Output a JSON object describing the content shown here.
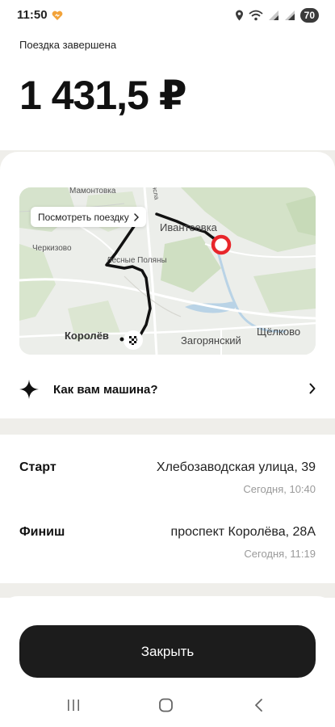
{
  "status_bar": {
    "time": "11:50",
    "battery": "70",
    "icons": [
      "heart-icon",
      "location-icon",
      "wifi-icon",
      "signal-icon",
      "signal-icon",
      "battery-icon"
    ]
  },
  "header": {
    "status": "Поездка завершена",
    "price": "1 431,5 ₽"
  },
  "map": {
    "view_trip_label": "Посмотреть поездку",
    "labels": {
      "mamontovka": "Мамонтовка",
      "cherkizovo": "Черкизово",
      "lesnye_polyany": "Лесные Поляны",
      "ivanteevka": "Ивантеевка",
      "korolev": "Королёв",
      "zagoryansky": "Загорянский",
      "shchelkovo": "Щёлково",
      "road_label": "ясла"
    }
  },
  "rating": {
    "label": "Как вам машина?"
  },
  "route": {
    "start": {
      "title": "Старт",
      "address": "Хлебозаводская улица, 39",
      "time": "Сегодня, 10:40"
    },
    "finish": {
      "title": "Финиш",
      "address": "проспект Королёва, 28А",
      "time": "Сегодня, 11:19"
    }
  },
  "actions": {
    "close_label": "Закрыть"
  },
  "colors": {
    "accent_button": "#1c1c1c",
    "start_marker": "#e8262b",
    "route_line": "#111111",
    "background_band": "#efeeea"
  }
}
